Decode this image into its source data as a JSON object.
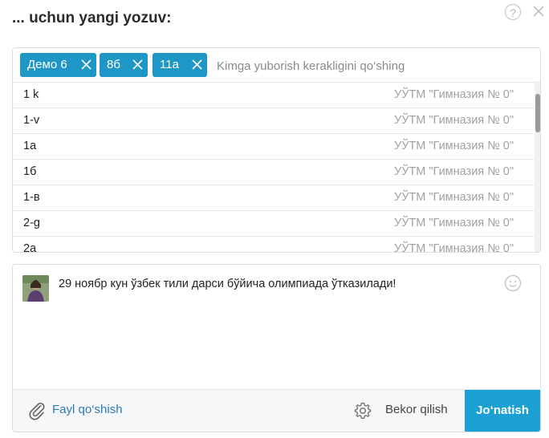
{
  "header": {
    "title": "... uchun yangi yozuv:",
    "help_label": "?"
  },
  "recipients": {
    "tags": [
      {
        "label": "Демо 6"
      },
      {
        "label": "8б"
      },
      {
        "label": "11а"
      }
    ],
    "placeholder": "Kimga yuborish kerakligini qo‘shing",
    "rows": [
      {
        "name": "1 k",
        "school": "УЎТМ \"Гимназия № 0\""
      },
      {
        "name": "1-v",
        "school": "УЎТМ \"Гимназия № 0\""
      },
      {
        "name": "1а",
        "school": "УЎТМ \"Гимназия № 0\""
      },
      {
        "name": "1б",
        "school": "УЎТМ \"Гимназия № 0\""
      },
      {
        "name": "1-в",
        "school": "УЎТМ \"Гимназия № 0\""
      },
      {
        "name": "2-g",
        "school": "УЎТМ \"Гимназия № 0\""
      },
      {
        "name": "2а",
        "school": "УЎТМ \"Гимназия № 0\""
      }
    ]
  },
  "composer": {
    "message": "29 ноябр кун ўзбек тили дарси бўйича олимпиада ўтказилади!",
    "attach_label": "Fayl qo‘shish",
    "cancel_label": "Bekor qilish",
    "send_label": "Jo‘natish"
  },
  "colors": {
    "accent": "#1f97c6",
    "send_button": "#1c9fd2",
    "link": "#2a7ab8"
  }
}
